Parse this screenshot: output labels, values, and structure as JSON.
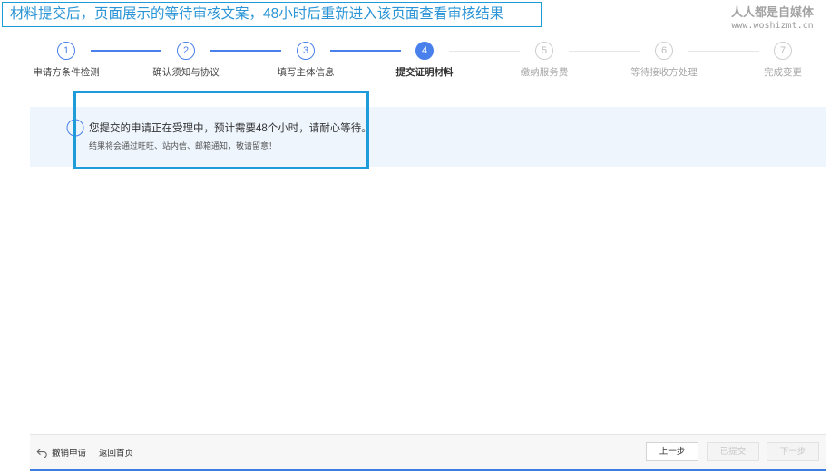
{
  "annotation": {
    "text": "材料提交后，页面展示的等待审核文案，48小时后重新进入该页面查看审核结果"
  },
  "watermark": {
    "name": "人人都是自媒体",
    "url": "www.woshizmt.cn"
  },
  "current_step": 4,
  "steps": [
    {
      "number": "1",
      "label": "申请方条件检测"
    },
    {
      "number": "2",
      "label": "确认须知与协议"
    },
    {
      "number": "3",
      "label": "填写主体信息"
    },
    {
      "number": "4",
      "label": "提交证明材料"
    },
    {
      "number": "5",
      "label": "缴纳服务费"
    },
    {
      "number": "6",
      "label": "等待接收方处理"
    },
    {
      "number": "7",
      "label": "完成变更"
    }
  ],
  "notice": {
    "icon": "info-icon",
    "message": "您提交的申请正在受理中，预计需要48个小时，请耐心等待。",
    "detail": "结果将会通过旺旺、站内信、邮箱通知，敬请留意！"
  },
  "footer": {
    "revoke_icon": "undo-icon",
    "revoke_label": "撤销申请",
    "home_label": "返回首页",
    "prev_label": "上一步",
    "submitted_label": "已提交",
    "next_label": "下一步"
  },
  "colors": {
    "accent": "#4a80ec",
    "annotation": "#1e9bd9",
    "notice_background": "#eef5fd",
    "footer_accent": "#3d7ddf"
  }
}
